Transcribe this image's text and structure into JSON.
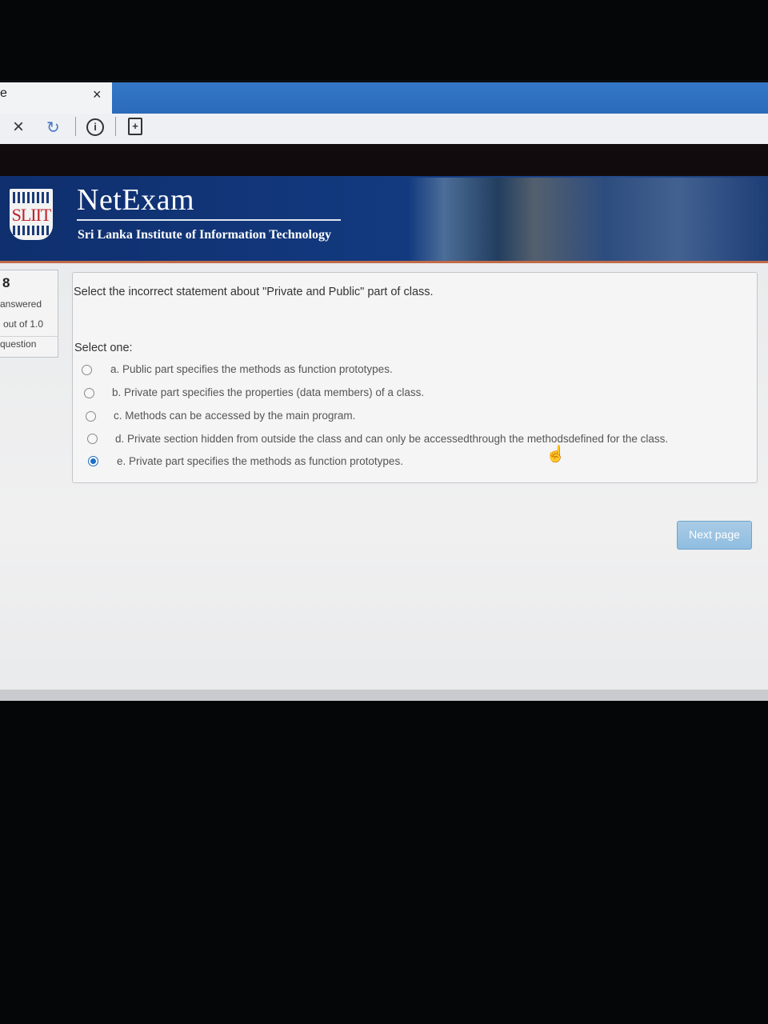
{
  "browser": {
    "tab_fragment": "e",
    "tab_close": "×",
    "stop": "×",
    "reload": "↻",
    "info": "i",
    "page_action": "+"
  },
  "header": {
    "brand": "NetExam",
    "subtitle": "Sri Lanka Institute of Information Technology",
    "logo_text": "SLIIT"
  },
  "question_info": {
    "number": "8",
    "status": "answered",
    "mark": "out of 1.0",
    "flag": "question"
  },
  "question": {
    "text": "Select the incorrect statement about \"Private and Public\" part of class.",
    "select_label": "Select one:",
    "options": [
      {
        "label": "a. Public part specifies the methods as function prototypes.",
        "selected": false
      },
      {
        "label": "b. Private part specifies the properties (data members) of a class.",
        "selected": false
      },
      {
        "label": "c. Methods can be accessed by the main program.",
        "selected": false
      },
      {
        "label": "d. Private section hidden from outside the class and can only be accessedthrough the methodsdefined for the class.",
        "selected": false
      },
      {
        "label": "e. Private part specifies the methods as function prototypes.",
        "selected": true
      }
    ]
  },
  "navigation": {
    "next_label": "Next page"
  },
  "colors": {
    "banner": "#133a80",
    "accent": "#1b6ec2",
    "next_button": "#8fbde0"
  }
}
